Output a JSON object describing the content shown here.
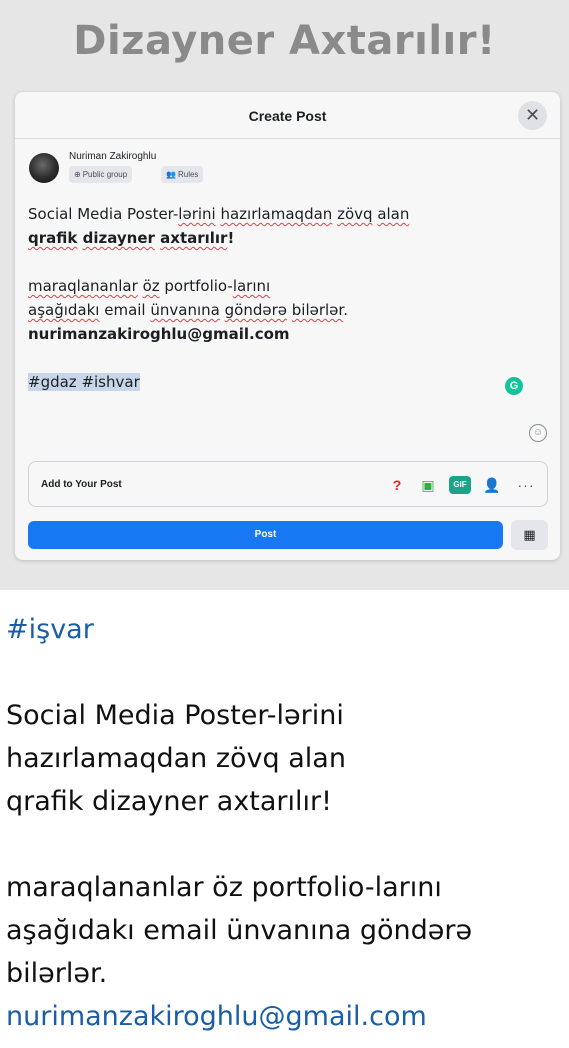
{
  "poster": {
    "title": "Dizayner Axtarılır!"
  },
  "dialog": {
    "title": "Create Post",
    "close_icon": "✕",
    "author": "Nuriman Zakiroghlu",
    "chips": {
      "group": "Public group",
      "rules": "Rules"
    },
    "body": {
      "line1_a": "Social Media Poster-",
      "line1_b": "lərini",
      "line1_c": " ",
      "line1_d": "hazırlamaqdan",
      "line1_e": " ",
      "line1_f": "zövq",
      "line1_g": " ",
      "line1_h": "alan",
      "line2_a": "qrafik",
      "line2_b": " ",
      "line2_c": "dizayner",
      "line2_d": " ",
      "line2_e": "axtarılır",
      "line2_f": "!",
      "line3_a": "maraqlananlar",
      "line3_b": " ",
      "line3_c": "öz",
      "line3_d": " portfolio-",
      "line3_e": "larını",
      "line4_a": "aşağıdakı",
      "line4_b": " email ",
      "line4_c": "ünvanına",
      "line4_d": " ",
      "line4_e": "göndərə",
      "line4_f": " ",
      "line4_g": "bilərlər",
      "line4_h": ".",
      "email": "nurimanzakiroghlu@gmail.com",
      "tags": "#gdaz #ishvar"
    },
    "add_to_post_label": "Add to Your Post",
    "tool_gif_label": "GIF",
    "post_button": "Post"
  },
  "caption": {
    "hashtag": "#işvar",
    "p1_line1": "Social Media Poster-lərini",
    "p1_line2": "hazırlamaqdan zövq alan",
    "p1_line3": "qrafik dizayner axtarılır!",
    "p2_line1": "maraqlananlar öz portfolio-larını",
    "p2_line2": "aşağıdakı email ünvanına göndərə",
    "p2_line3": "bilərlər.",
    "email": "nurimanzakiroghlu@gmail.com"
  },
  "colors": {
    "accent": "#1877f2",
    "link": "#1a5ea8",
    "poster_title": "#8a8a8a",
    "grammarly": "#15c39a"
  },
  "icons": [
    "close-icon",
    "globe-icon",
    "people-icon",
    "grammarly-icon",
    "smiley-icon",
    "question-icon",
    "photo-icon",
    "gif-icon",
    "tag-person-icon",
    "more-icon",
    "table-icon"
  ]
}
